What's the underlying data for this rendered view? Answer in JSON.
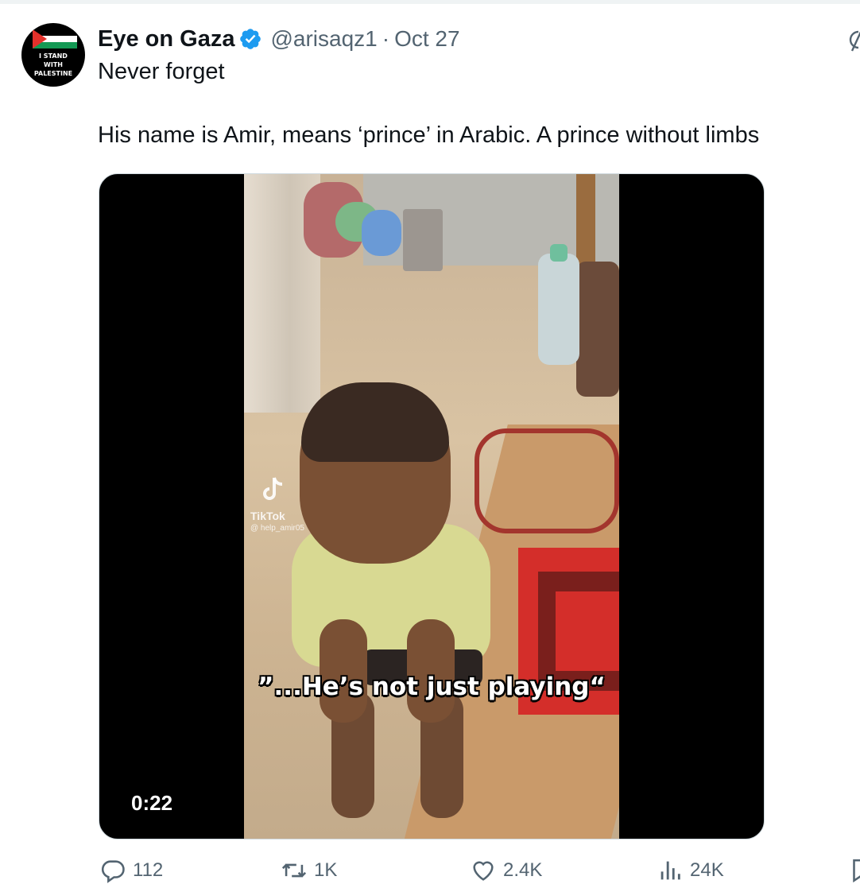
{
  "tweet": {
    "avatar_text": [
      "I STAND",
      "WITH",
      "PALESTINE"
    ],
    "display_name": "Eye on Gaza",
    "handle": "@arisaqz1",
    "separator": "·",
    "date": "Oct 27",
    "text_lines": [
      "Never forget",
      "His name is Amir, means ‘prince’ in Arabic. A prince without limbs"
    ]
  },
  "media": {
    "watermark_name": "TikTok",
    "watermark_user": "@ help_amir05",
    "caption": "”...He’s not just playing“",
    "duration": "0:22"
  },
  "actions": {
    "reply_count": "112",
    "repost_count": "1K",
    "like_count": "2.4K",
    "view_count": "24K"
  },
  "icons": {
    "verified": "verified-badge-icon",
    "reply": "reply-icon",
    "repost": "repost-icon",
    "like": "heart-icon",
    "views": "views-chart-icon",
    "bookmark": "bookmark-icon",
    "grok": "grok-icon"
  },
  "colors": {
    "verified_blue": "#1d9bf0",
    "secondary_text": "#536471",
    "primary_text": "#0f1419"
  }
}
